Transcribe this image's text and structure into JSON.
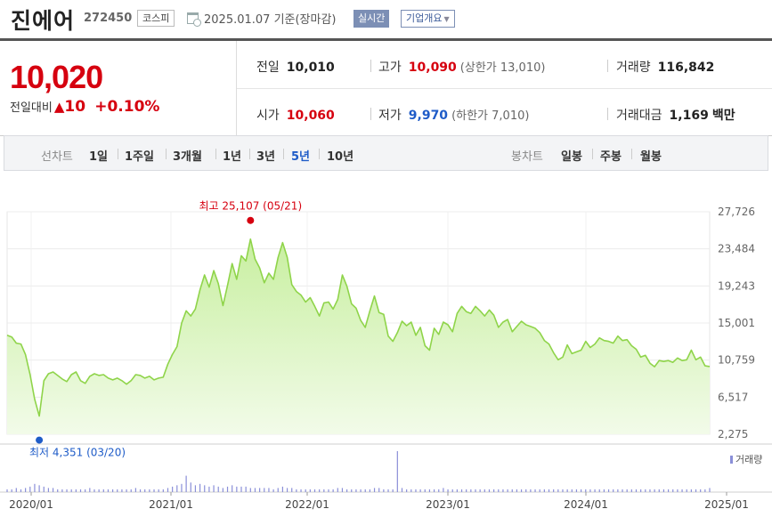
{
  "header": {
    "stock_name": "진에어",
    "stock_code": "272450",
    "market": "코스피",
    "date_text": "2025.01.07 기준(장마감)",
    "realtime_label": "실시간",
    "company_overview_label": "기업개요"
  },
  "price": {
    "current": "10,020",
    "change_label": "전일대비",
    "change_value": "10",
    "change_pct": "+0.10%"
  },
  "summary": {
    "prev_close": {
      "label": "전일",
      "value": "10,010"
    },
    "high": {
      "label": "고가",
      "value": "10,090",
      "sub": "(상한가 13,010)"
    },
    "volume": {
      "label": "거래량",
      "value": "116,842"
    },
    "open": {
      "label": "시가",
      "value": "10,060"
    },
    "low": {
      "label": "저가",
      "value": "9,970",
      "sub": "(하한가 7,010)"
    },
    "trade_amount": {
      "label": "거래대금",
      "value": "1,169",
      "unit": "백만"
    }
  },
  "tabs": {
    "line_chart_label": "선차트",
    "line_periods": [
      "1일",
      "1주일",
      "3개월",
      "1년",
      "3년",
      "5년",
      "10년"
    ],
    "active_period": "5년",
    "candle_chart_label": "봉차트",
    "candle_periods": [
      "일봉",
      "주봉",
      "월봉"
    ]
  },
  "colors": {
    "up": "#d6000f",
    "down": "#1f5cc8",
    "line": "#8fd44a",
    "fill": "#d9f5bd"
  },
  "chart_data": {
    "type": "area",
    "title": "",
    "xlabel": "",
    "ylabel": "",
    "y_ticks": [
      "27,726",
      "23,484",
      "19,243",
      "15,001",
      "10,759",
      "6,517",
      "2,275"
    ],
    "ylim": [
      2275,
      27726
    ],
    "x_ticks": [
      "2020/01",
      "2021/01",
      "2022/01",
      "2023/01",
      "2024/01",
      "2025/01"
    ],
    "max_annotation": "최고 25,107 (05/21)",
    "min_annotation": "최저 4,351 (03/20)",
    "volume_label": "거래량",
    "grid": true,
    "series": [
      {
        "values": [
          13600,
          13400,
          12700,
          12600,
          11400,
          9100,
          6300,
          4351,
          8400,
          9200,
          9400,
          9000,
          8600,
          8300,
          9100,
          9400,
          8400,
          8100,
          8900,
          9200,
          9000,
          9100,
          8700,
          8500,
          8700,
          8400,
          8000,
          8400,
          9100,
          9000,
          8700,
          8900,
          8500,
          8700,
          8800,
          10300,
          11400,
          12300,
          15000,
          16400,
          15800,
          16600,
          18800,
          20500,
          19100,
          21000,
          19500,
          17000,
          19300,
          21800,
          20000,
          22700,
          22100,
          24600,
          22300,
          21300,
          19600,
          20700,
          20000,
          22500,
          24200,
          22500,
          19400,
          18600,
          18200,
          17400,
          17900,
          16900,
          15800,
          17300,
          17400,
          16600,
          17700,
          20500,
          19200,
          17200,
          16700,
          15300,
          14500,
          16400,
          18100,
          16200,
          16000,
          13500,
          12900,
          13900,
          15200,
          14700,
          15100,
          13600,
          14500,
          12400,
          11900,
          14400,
          13700,
          15100,
          14800,
          14000,
          16100,
          16900,
          16300,
          16100,
          16900,
          16400,
          15800,
          16500,
          15900,
          14500,
          15100,
          15400,
          14000,
          14600,
          15200,
          14800,
          14600,
          14400,
          13900,
          13000,
          12600,
          11600,
          10800,
          11100,
          12500,
          11500,
          11700,
          11900,
          12900,
          12200,
          12600,
          13300,
          13000,
          12900,
          12700,
          13500,
          13000,
          13100,
          12400,
          12000,
          11100,
          11300,
          10400,
          10000,
          10700,
          10600,
          10700,
          10500,
          11000,
          10700,
          10800,
          11900,
          10800,
          11100,
          10100,
          10020
        ]
      }
    ],
    "volume": [
      2,
      2,
      3,
      2,
      3,
      4,
      6,
      5,
      4,
      3,
      3,
      2,
      2,
      2,
      2,
      2,
      2,
      2,
      3,
      2,
      2,
      2,
      2,
      2,
      2,
      2,
      2,
      2,
      3,
      2,
      2,
      2,
      2,
      2,
      2,
      3,
      4,
      5,
      6,
      12,
      7,
      5,
      6,
      5,
      4,
      5,
      4,
      3,
      4,
      5,
      4,
      4,
      4,
      3,
      3,
      3,
      3,
      3,
      2,
      3,
      4,
      3,
      3,
      2,
      2,
      2,
      2,
      2,
      2,
      2,
      2,
      2,
      3,
      3,
      2,
      2,
      2,
      2,
      2,
      2,
      3,
      3,
      2,
      2,
      2,
      30,
      3,
      2,
      2,
      2,
      2,
      2,
      2,
      2,
      2,
      3,
      2,
      2,
      2,
      2,
      2,
      2,
      2,
      2,
      2,
      2,
      2,
      2,
      2,
      2,
      2,
      2,
      2,
      2,
      2,
      2,
      2,
      2,
      2,
      2,
      2,
      2,
      2,
      2,
      2,
      2,
      2,
      2,
      2,
      2,
      2,
      2,
      2,
      2,
      2,
      2,
      2,
      2,
      2,
      2,
      2,
      2,
      2,
      2,
      2,
      2,
      2,
      2,
      2,
      2,
      2,
      2,
      2,
      3
    ]
  }
}
